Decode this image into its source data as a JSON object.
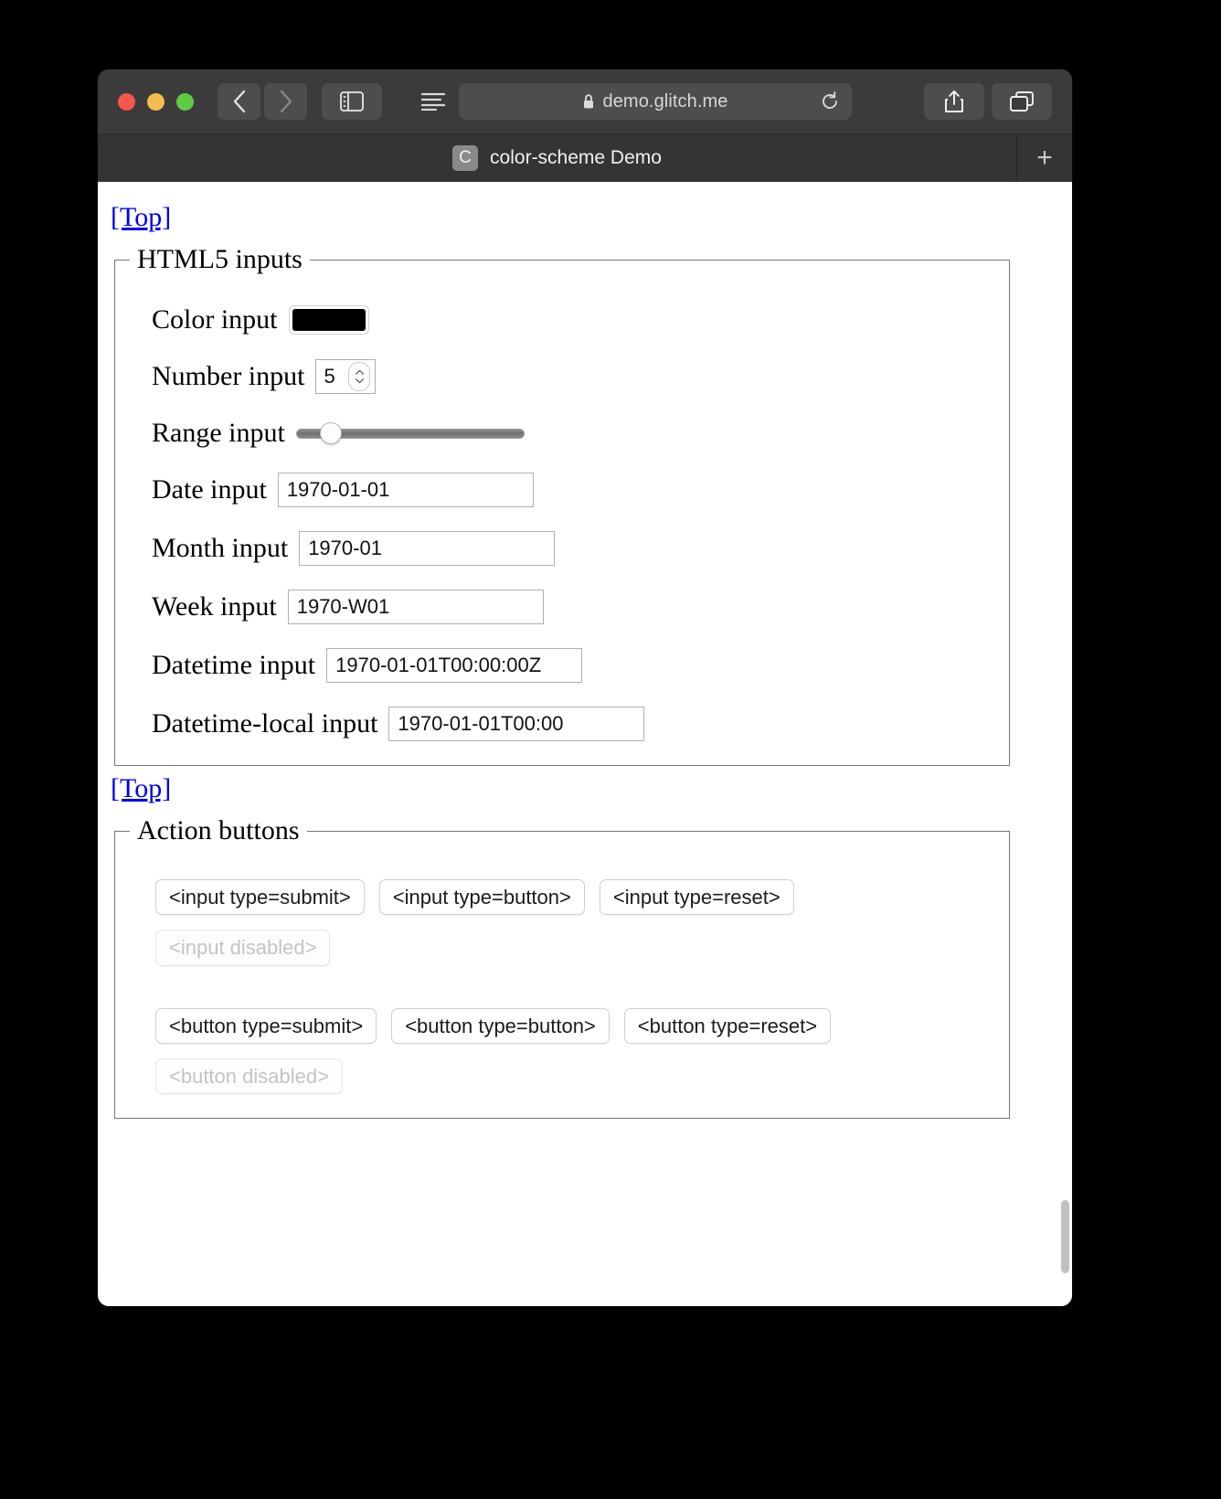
{
  "window": {
    "traffic_lights": [
      "close",
      "minimize",
      "zoom"
    ],
    "toolbar": {
      "back_label": "‹",
      "forward_label": "›",
      "sidebar_icon": "sidebar-icon",
      "reader_icon": "reader-view-icon",
      "lock_icon": "lock-icon",
      "url": "demo.glitch.me",
      "url_prefix": "",
      "reload_icon": "reload-icon",
      "share_icon": "share-icon",
      "tabs_icon": "tab-overview-icon"
    },
    "tab_bar": {
      "favicon_letter": "C",
      "tab_title": "color-scheme Demo",
      "new_tab_label": "+"
    }
  },
  "page": {
    "top_link_1": "[Top]",
    "top_link_2": "[Top]",
    "sections": {
      "html5_inputs": {
        "legend": "HTML5 inputs",
        "fields": [
          {
            "label": "Color input",
            "value": "#000000",
            "kind": "color"
          },
          {
            "label": "Number input",
            "value": "5",
            "kind": "number"
          },
          {
            "label": "Range input",
            "value": "10",
            "kind": "range"
          },
          {
            "label": "Date input",
            "value": "1970-01-01",
            "kind": "date"
          },
          {
            "label": "Month input",
            "value": "1970-01",
            "kind": "month"
          },
          {
            "label": "Week input",
            "value": "1970-W01",
            "kind": "week"
          },
          {
            "label": "Datetime input",
            "value": "1970-01-01T00:00:00Z",
            "kind": "datetime"
          },
          {
            "label": "Datetime-local input",
            "value": "1970-01-01T00:00",
            "kind": "datetime-local"
          }
        ]
      },
      "action_buttons": {
        "legend": "Action buttons",
        "row1": [
          "<input type=submit>",
          "<input type=button>",
          "<input type=reset>"
        ],
        "row2": [
          "<input disabled>"
        ],
        "row3": [
          "<button type=submit>",
          "<button type=button>",
          "<button type=reset>"
        ],
        "row4": [
          "<button disabled>"
        ]
      }
    }
  },
  "colors": {
    "link": "#0000ee",
    "color_input_swatch": "#000000",
    "chrome_bg": "#3b3b3b",
    "tabbar_bg": "#343434",
    "page_bg": "#ffffff"
  }
}
